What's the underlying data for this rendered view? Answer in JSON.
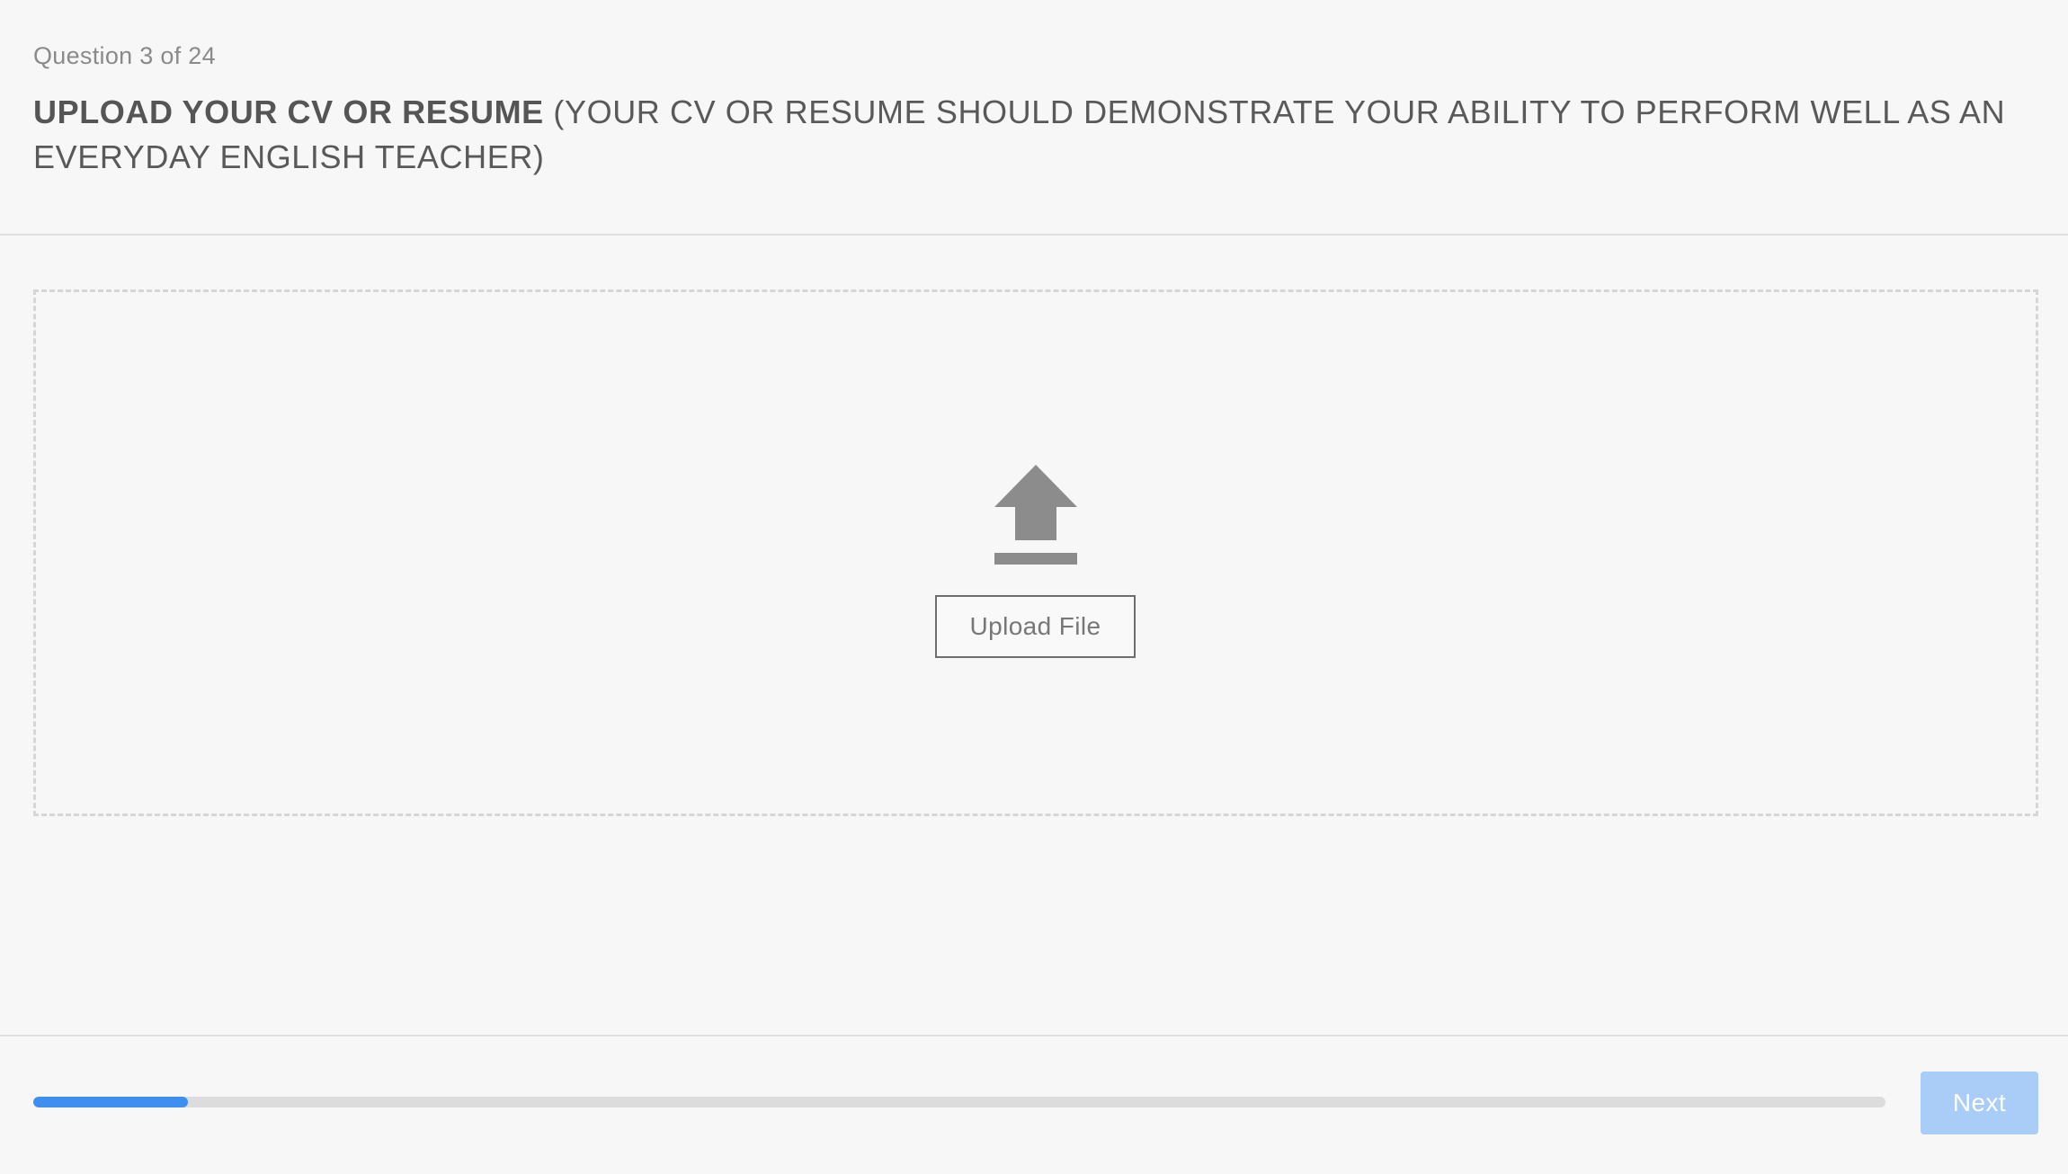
{
  "header": {
    "question_counter": "Question 3 of 24",
    "question_title_bold": "UPLOAD YOUR CV OR RESUME",
    "question_title_rest": " (YOUR CV OR RESUME SHOULD DEMONSTRATE YOUR ABILITY TO PERFORM WELL AS AN EVERYDAY ENGLISH TEACHER)"
  },
  "dropzone": {
    "icon": "upload-icon",
    "upload_button_label": "Upload File"
  },
  "footer": {
    "progress_fraction": 0.0833,
    "progress_color": "#3d8ff0",
    "next_label": "Next",
    "next_button_color": "#a9cdf7"
  }
}
